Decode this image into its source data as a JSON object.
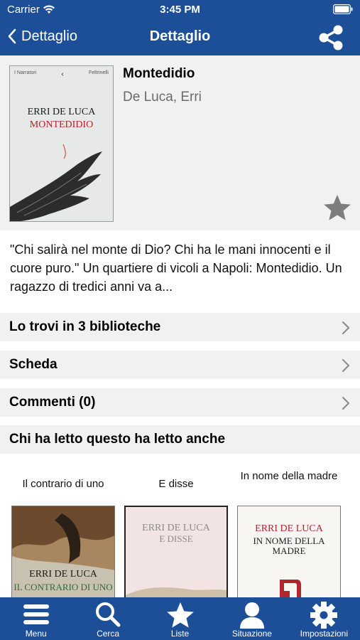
{
  "status": {
    "carrier": "Carrier",
    "time": "3:45 PM"
  },
  "nav": {
    "back_label": "Dettaglio",
    "title": "Dettaglio"
  },
  "book": {
    "title": "Montedidio",
    "author": "De Luca, Erri",
    "cover": {
      "author": "ERRI DE LUCA",
      "title": "MONTEDIDIO",
      "publisher": "I Narratori",
      "imprint": "Feltrinelli"
    },
    "synopsis": "\"Chi salirà nel monte di Dio? Chi ha le mani innocenti e il cuore puro.\" Un quartiere di vicoli a Napoli: Montedidio. Un ragazzo di tredici anni va a..."
  },
  "rows": {
    "libraries": "Lo trovi in 3 biblioteche",
    "card": "Scheda",
    "comments": "Commenti (0)",
    "also_read": "Chi ha letto questo ha letto anche"
  },
  "related": [
    {
      "label": "Il contrario di uno",
      "cover_author": "ERRI DE LUCA",
      "cover_title": "IL CONTRARIO DI UNO"
    },
    {
      "label": "E disse",
      "cover_author": "ERRI DE LUCA",
      "cover_title": "E DISSE"
    },
    {
      "label": "In nome della madre",
      "cover_author": "ERRI DE LUCA",
      "cover_title": "IN NOME DELLA MADRE"
    }
  ],
  "tabs": [
    {
      "label": "Menu",
      "icon": "menu-icon"
    },
    {
      "label": "Cerca",
      "icon": "search-icon"
    },
    {
      "label": "Liste",
      "icon": "star-icon"
    },
    {
      "label": "Situazione",
      "icon": "person-icon"
    },
    {
      "label": "Impostazioni",
      "icon": "gear-icon"
    }
  ],
  "colors": {
    "brand": "#1d4f99",
    "section_bg": "#f1f1f1",
    "star": "#7d7d7d"
  }
}
